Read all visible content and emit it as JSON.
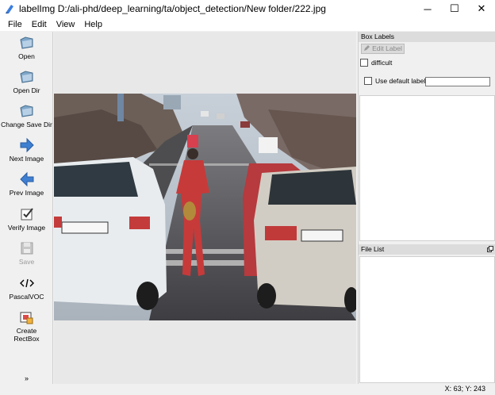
{
  "window": {
    "title": "labelImg D:/ali-phd/deep_learning/ta/object_detection/New folder/222.jpg",
    "controls": {
      "minimize": "─",
      "maximize": "☐",
      "close": "✕"
    }
  },
  "menu": [
    "File",
    "Edit",
    "View",
    "Help"
  ],
  "toolbar": {
    "open": "Open",
    "open_dir": "Open Dir",
    "change_save_dir": "Change Save Dir",
    "next_image": "Next Image",
    "prev_image": "Prev Image",
    "verify_image": "Verify Image",
    "save": "Save",
    "format": "PascalVOC",
    "create_rectbox_line1": "Create",
    "create_rectbox_line2": "RectBox",
    "more": "»"
  },
  "box_labels": {
    "title": "Box Labels",
    "edit_label": "Edit Label",
    "difficult": "difficult",
    "use_default_label": "Use default label",
    "default_label_value": ""
  },
  "file_list": {
    "title": "File List"
  },
  "status": {
    "coords": "X: 63; Y: 243"
  }
}
